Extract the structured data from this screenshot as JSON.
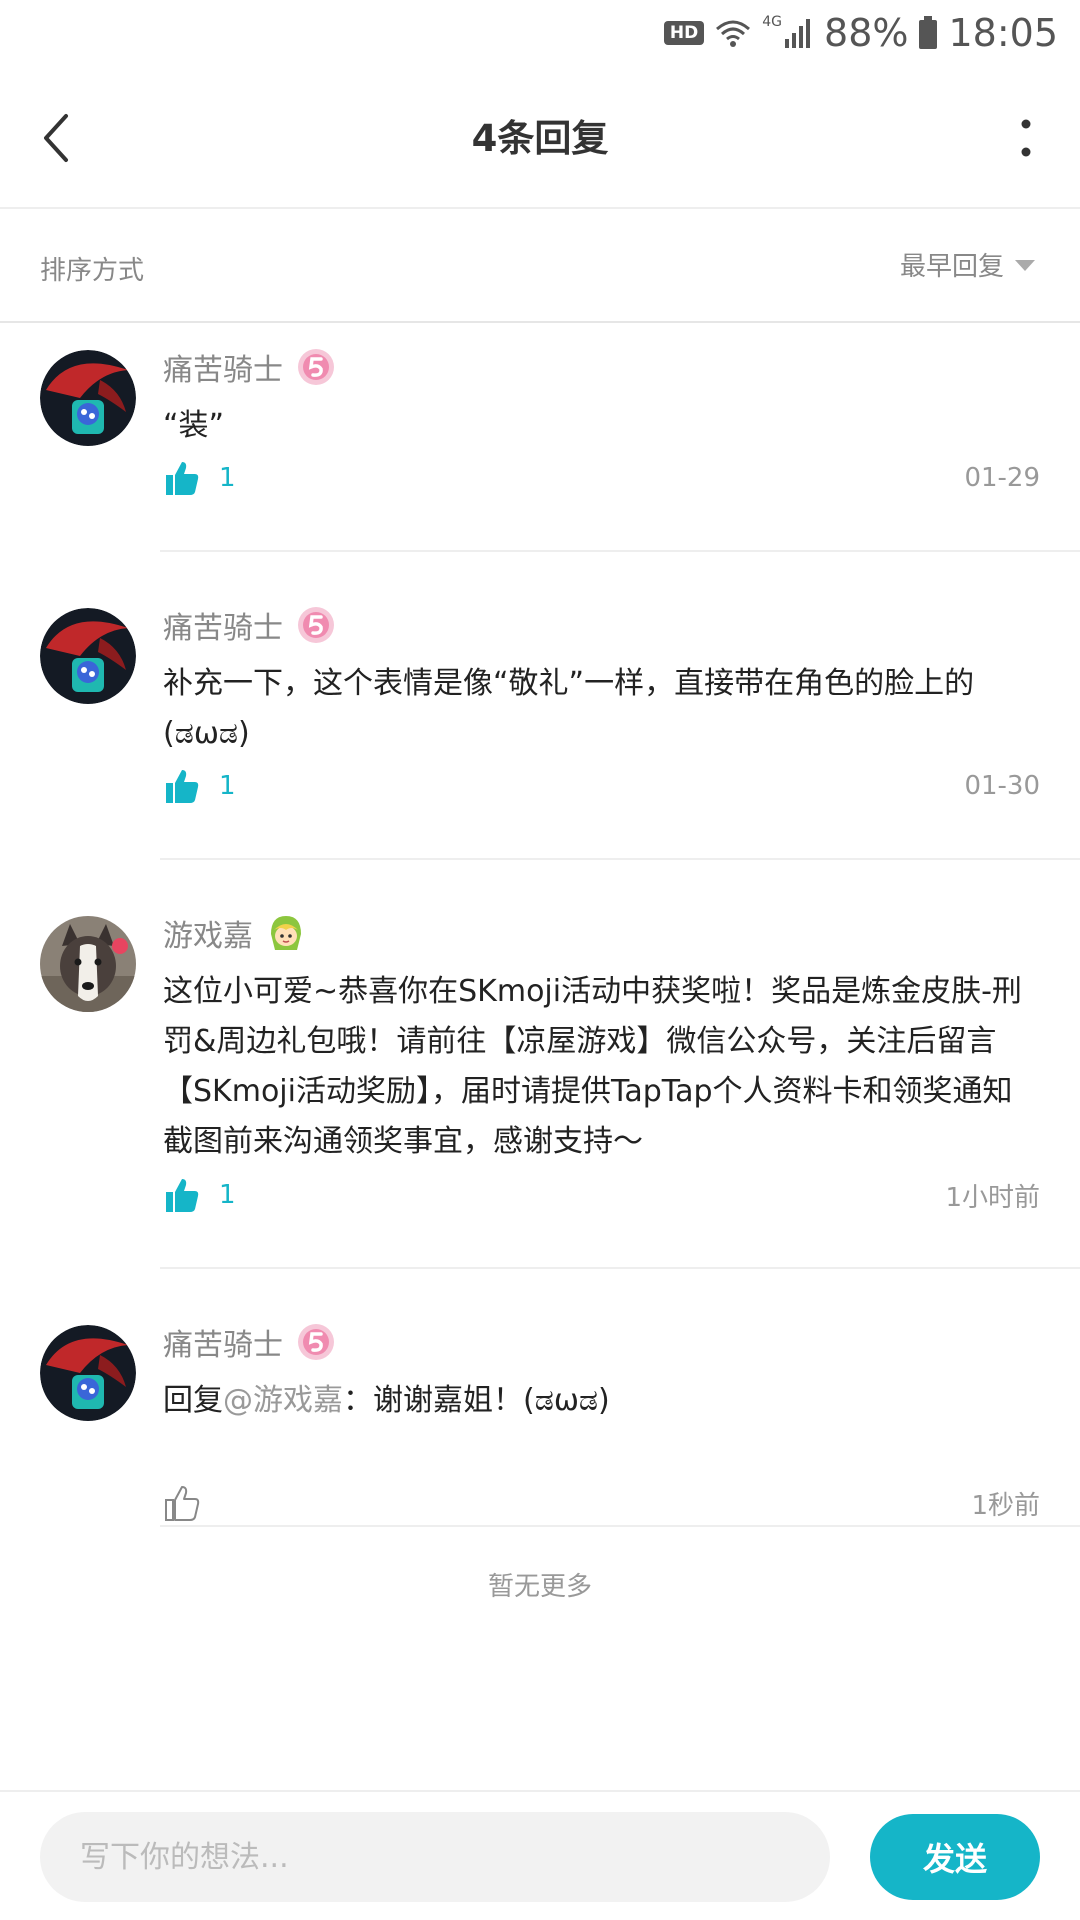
{
  "status_bar": {
    "hd_label": "HD",
    "network_label": "4G",
    "battery_percent": "88%",
    "time": "18:05",
    "icons": [
      "wifi-icon",
      "signal-icon",
      "battery-icon"
    ]
  },
  "header": {
    "title": "4条回复",
    "back_icon": "chevron-left-icon",
    "more_icon": "more-vertical-icon"
  },
  "sort": {
    "label": "排序方式",
    "value": "最早回复",
    "icon": "caret-down-icon"
  },
  "replies": [
    {
      "username": "痛苦骑士",
      "avatar": "dark-character-avatar",
      "badge": "level-5-badge",
      "content": "“装”",
      "likes": "1",
      "liked": true,
      "time": "01-29"
    },
    {
      "username": "痛苦骑士",
      "avatar": "dark-character-avatar",
      "badge": "level-5-badge",
      "content": "补充一下，这个表情是像“敬礼”一样，直接带在角色的脸上的 (ಡωಡ)",
      "likes": "1",
      "liked": true,
      "time": "01-30"
    },
    {
      "username": "游戏嘉",
      "avatar": "dog-photo-avatar",
      "badge": "green-hair-character-badge",
      "content": "这位小可爱~恭喜你在SKmoji活动中获奖啦！奖品是炼金皮肤-刑罚&周边礼包哦！请前往【凉屋游戏】微信公众号，关注后留言【SKmoji活动奖励】，届时请提供TapTap个人资料卡和领奖通知截图前来沟通领奖事宜，感谢支持～",
      "likes": "1",
      "liked": true,
      "time": "1小时前"
    },
    {
      "username": "痛苦骑士",
      "avatar": "dark-character-avatar",
      "badge": "level-5-badge",
      "content_prefix": "回复",
      "mention": "@游戏嘉",
      "content": "：谢谢嘉姐！(ಡωಡ)",
      "likes": "",
      "liked": false,
      "time": "1秒前"
    }
  ],
  "no_more_text": "暂无更多",
  "composer": {
    "placeholder": "写下你的想法...",
    "value": "",
    "send_label": "发送"
  },
  "colors": {
    "accent": "#15b5c8",
    "badge_pink": "#f08bb0",
    "text_primary": "#222222",
    "text_secondary": "#888888",
    "divider": "#eeeeee"
  }
}
